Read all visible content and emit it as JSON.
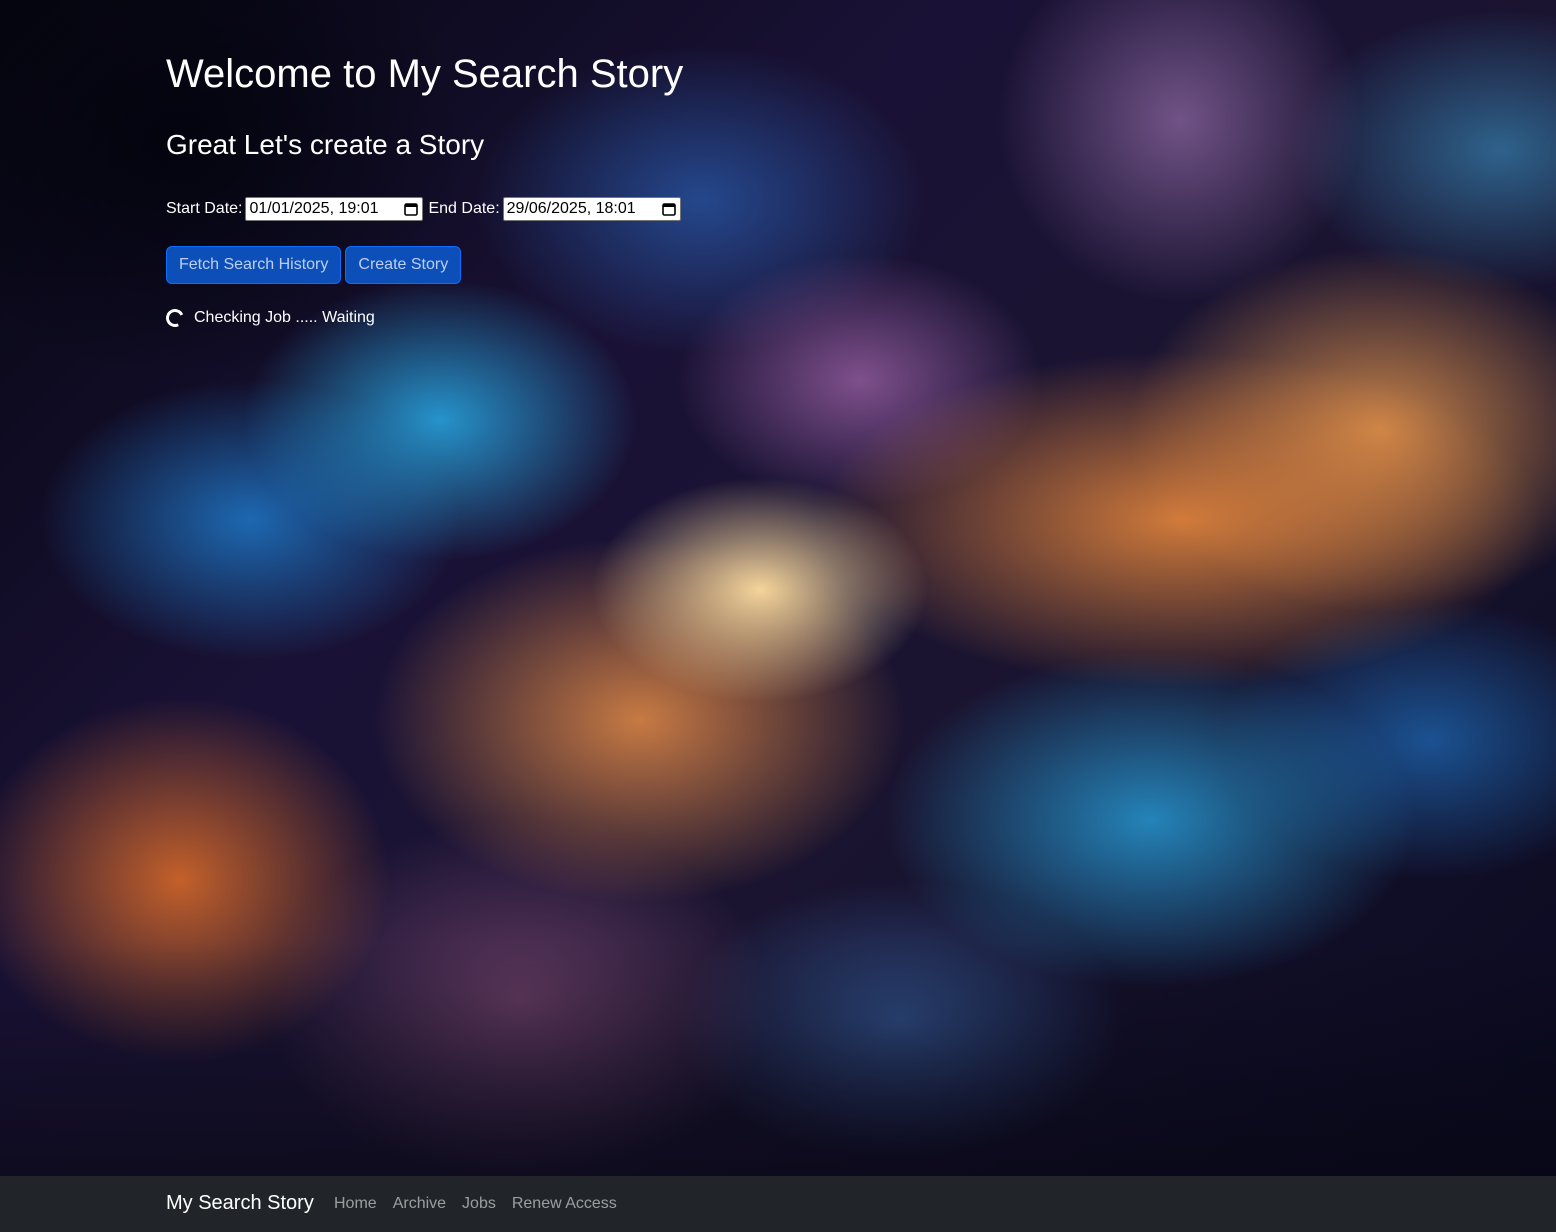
{
  "page": {
    "title": "Welcome to My Search Story",
    "subtitle": "Great Let's create a Story"
  },
  "dates": {
    "start_label": "Start Date:",
    "start_value": "01/01/2025, 19:01",
    "end_label": "End Date:",
    "end_value": "29/06/2025, 18:01"
  },
  "actions": {
    "fetch_label": "Fetch Search History",
    "create_label": "Create Story"
  },
  "status": {
    "text": "Checking Job ..... Waiting"
  },
  "navbar": {
    "brand": "My Search Story",
    "links": [
      "Home",
      "Archive",
      "Jobs",
      "Renew Access"
    ]
  },
  "colors": {
    "primary": "#0d6efd",
    "navbar_bg": "#212529"
  },
  "icons": {
    "date_picker": "calendar-icon",
    "loading": "spinner-icon"
  }
}
